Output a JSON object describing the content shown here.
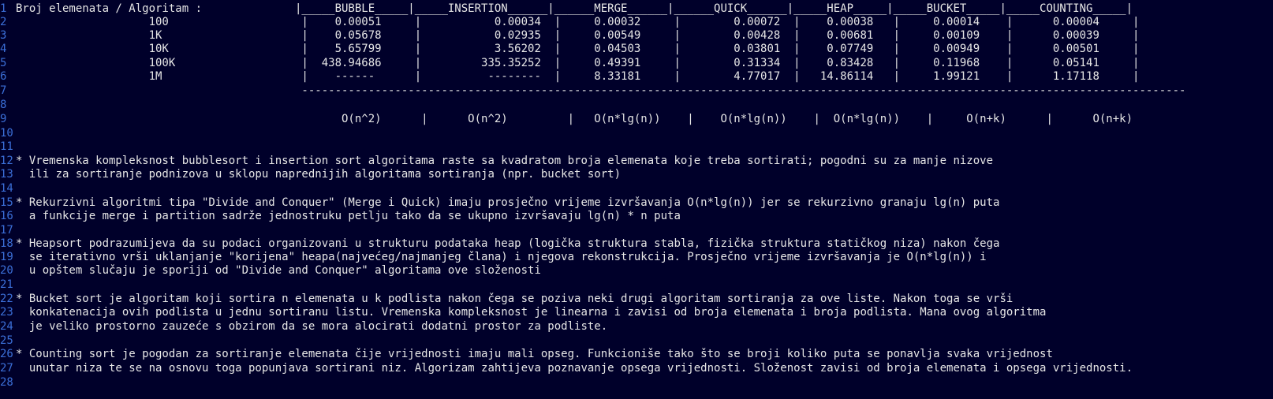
{
  "theme": {
    "background": "#00002a",
    "text": "#e6e6e6",
    "line_number": "#3b6fd8"
  },
  "editor": {
    "lines": [
      {
        "n": "1",
        "text": "Broj elemenata / Algoritam :              |_____BUBBLE_____|_____INSERTION______|______MERGE______|______QUICK______|_____HEAP_____|_____BUCKET_____|_____COUNTING_____|"
      },
      {
        "n": "2",
        "text": "                    100                    |    0.00051     |           0.00034  |     0.00032     |        0.00072  |    0.00038   |     0.00014    |      0.00004     |"
      },
      {
        "n": "3",
        "text": "                    1K                     |    0.05678     |           0.02935  |     0.00549     |        0.00428  |    0.00681   |     0.00109    |      0.00039     |"
      },
      {
        "n": "4",
        "text": "                    10K                    |    5.65799     |           3.56202  |     0.04503     |        0.03801  |    0.07749   |     0.00949    |      0.00501     |"
      },
      {
        "n": "5",
        "text": "                    100K                   |  438.94686     |         335.35252  |     0.49391     |        0.31334  |    0.83428   |     0.11968    |      0.05141     |"
      },
      {
        "n": "6",
        "text": "                    1M                     |    ------      |          --------  |     8.33181     |        4.77017  |   14.86114   |     1.99121    |      1.17118     |"
      },
      {
        "n": "7",
        "text": "                                           -------------------------------------------------------------------------------------------------------------------------------------"
      },
      {
        "n": "8",
        "text": ""
      },
      {
        "n": "9",
        "text": "                                                 O(n^2)      |      O(n^2)         |   O(n*lg(n))    |    O(n*lg(n))    |  O(n*lg(n))    |     O(n+k)      |      O(n+k)"
      },
      {
        "n": "10",
        "text": ""
      },
      {
        "n": "11",
        "text": ""
      },
      {
        "n": "12",
        "text": "* Vremenska kompleksnost bubblesort i insertion sort algoritama raste sa kvadratom broja elemenata koje treba sortirati; pogodni su za manje nizove"
      },
      {
        "n": "13",
        "text": "  ili za sortiranje podnizova u sklopu naprednijih algoritama sortiranja (npr. bucket sort)"
      },
      {
        "n": "14",
        "text": ""
      },
      {
        "n": "15",
        "text": "* Rekurzivni algoritmi tipa \"Divide and Conquer\" (Merge i Quick) imaju prosječno vrijeme izvršavanja O(n*lg(n)) jer se rekurzivno granaju lg(n) puta"
      },
      {
        "n": "16",
        "text": "  a funkcije merge i partition sadrže jednostruku petlju tako da se ukupno izvršavaju lg(n) * n puta"
      },
      {
        "n": "17",
        "text": ""
      },
      {
        "n": "18",
        "text": "* Heapsort podrazumijeva da su podaci organizovani u strukturu podataka heap (logička struktura stabla, fizička struktura statičkog niza) nakon čega"
      },
      {
        "n": "19",
        "text": "  se iterativno vrši uklanjanje \"korijena\" heapa(najvećeg/najmanjeg člana) i njegova rekonstrukcija. Prosječno vrijeme izvršavanja je O(n*lg(n)) i"
      },
      {
        "n": "20",
        "text": "  u opštem slučaju je sporiji od \"Divide and Conquer\" algoritama ove složenosti"
      },
      {
        "n": "21",
        "text": ""
      },
      {
        "n": "22",
        "text": "* Bucket sort je algoritam koji sortira n elemenata u k podlista nakon čega se poziva neki drugi algoritam sortiranja za ove liste. Nakon toga se vrši"
      },
      {
        "n": "23",
        "text": "  konkatenacija ovih podlista u jednu sortiranu listu. Vremenska kompleksnost je linearna i zavisi od broja elemenata i broja podlista. Mana ovog algoritma"
      },
      {
        "n": "24",
        "text": "  je veliko prostorno zauzeće s obzirom da se mora alocirati dodatni prostor za podliste."
      },
      {
        "n": "25",
        "text": ""
      },
      {
        "n": "26",
        "text": "* Counting sort je pogodan za sortiranje elemenata čije vrijednosti imaju mali opseg. Funkcioniše tako što se broji koliko puta se ponavlja svaka vrijednost"
      },
      {
        "n": "27",
        "text": "  unutar niza te se na osnovu toga popunjava sortirani niz. Algorizam zahtijeva poznavanje opsega vrijednosti. Složenost zavisi od broja elemenata i opsega vrijednosti."
      },
      {
        "n": "28",
        "text": ""
      }
    ]
  }
}
